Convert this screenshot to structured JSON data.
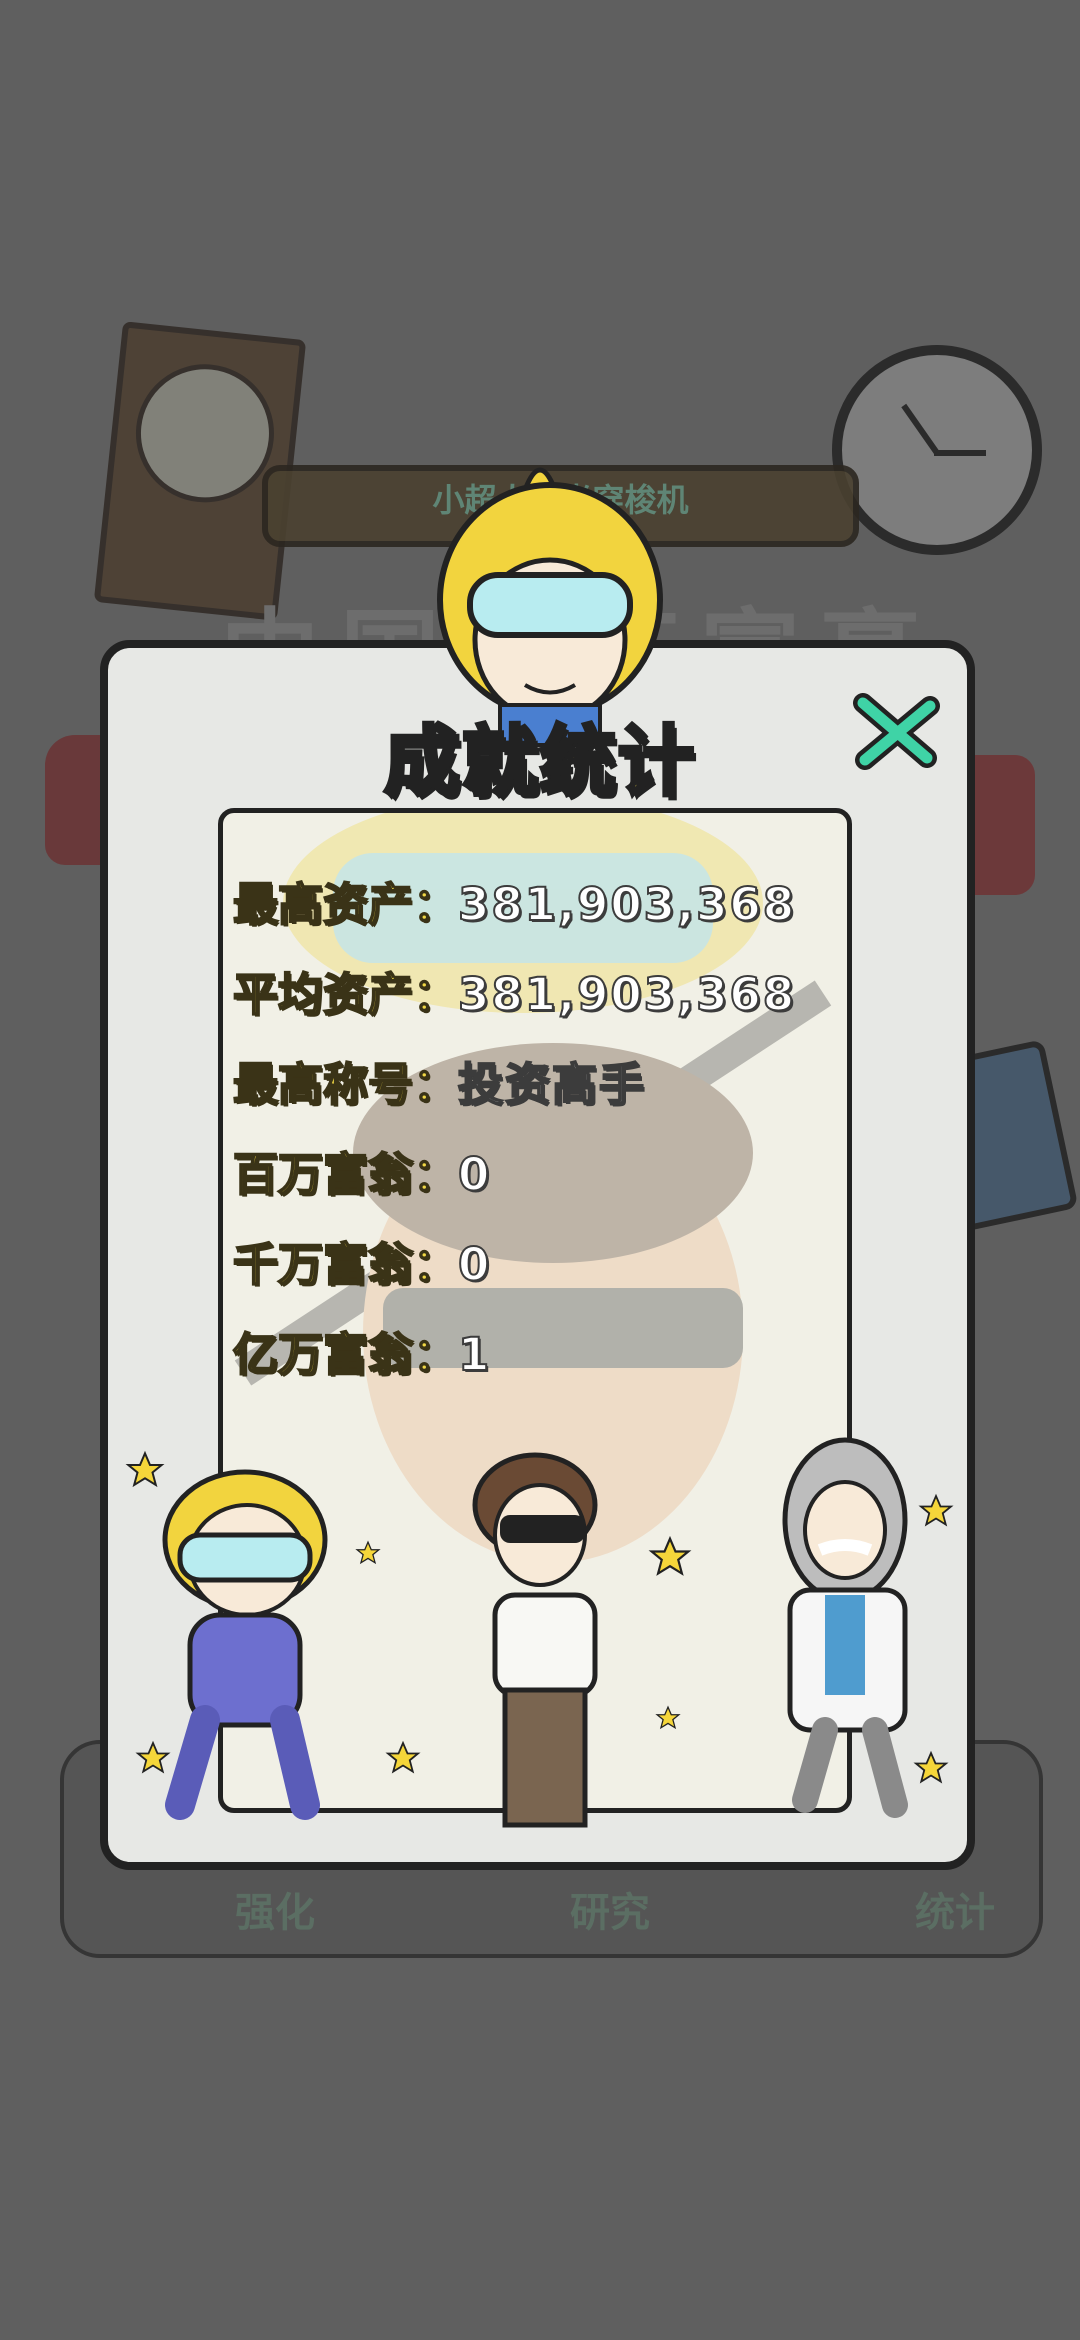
{
  "background": {
    "banner_text": "小超人时光穿梭机",
    "big_title": "中国亿万富豪",
    "nav": [
      {
        "label": "强化",
        "icon": "upgrade-icon"
      },
      {
        "label": "研究",
        "icon": "research-icon"
      },
      {
        "label": "统计",
        "icon": "stats-icon"
      }
    ]
  },
  "dialog": {
    "title": "成就统计",
    "close_icon": "close-x-icon",
    "stats": [
      {
        "label": "最高资产：",
        "value": "381,903,368"
      },
      {
        "label": "平均资产：",
        "value": "381,903,368"
      },
      {
        "label": "最高称号：",
        "value": "投资高手"
      },
      {
        "label": "百万富翁：",
        "value": "0"
      },
      {
        "label": "千万富翁：",
        "value": "0"
      },
      {
        "label": "亿万富翁：",
        "value": "1"
      }
    ]
  },
  "colors": {
    "title_yellow": "#f6e04b",
    "label_yellow": "#f1d845",
    "panel_bg": "#e7e8e5",
    "overlay": "#5f5f5f",
    "close_green": "#3fd3a6"
  }
}
